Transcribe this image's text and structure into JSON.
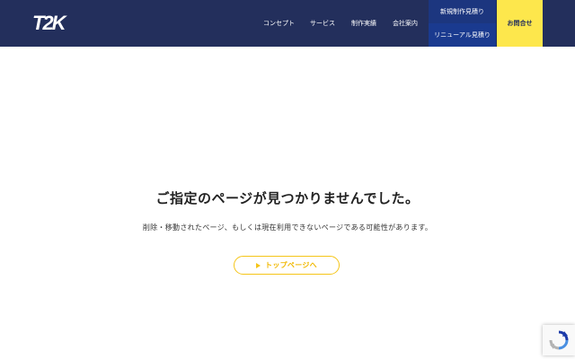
{
  "header": {
    "logo_text": "T2K",
    "nav": [
      {
        "label": "コンセプト"
      },
      {
        "label": "サービス"
      },
      {
        "label": "制作実績"
      },
      {
        "label": "会社案内"
      }
    ],
    "estimate_new": "新規制作見積り",
    "estimate_renewal": "リニューアル見積り",
    "contact": "お問合せ"
  },
  "main": {
    "title": "ご指定のページが見つかりませんでした。",
    "message": "削除・移動されたページ、もしくは現在利用できないページである可能性があります。",
    "home_button": "トップページへ"
  },
  "colors": {
    "header_bg": "#232f5c",
    "estimate_bg": "#1e3a8a",
    "contact_bg": "#fde74c",
    "accent_yellow": "#f5c518"
  },
  "icons": {
    "recaptcha": "recaptcha-icon",
    "button_arrow": "play-triangle-icon"
  }
}
